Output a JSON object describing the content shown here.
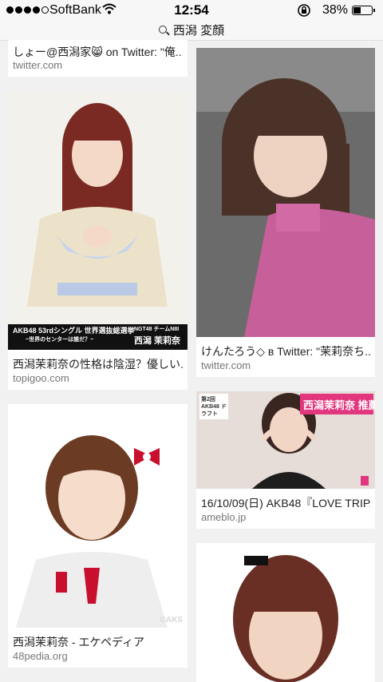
{
  "status_bar": {
    "carrier": "SoftBank",
    "time": "12:54",
    "battery_percent": "38%",
    "battery_level": 0.38,
    "signal_bars_filled": 4,
    "signal_bars_total": 5
  },
  "url_bar": {
    "query": "西潟 変顔"
  },
  "results": [
    {
      "title": "しょー@西潟家😸 on Twitter: \"俺...",
      "source": "twitter.com"
    },
    {
      "title": "けんたろう◇ в Twitter: \"茉莉奈ち...",
      "source": "twitter.com"
    },
    {
      "title": "西潟茉莉奈の性格は陰湿？優しい...",
      "source": "topigoo.com",
      "image_text": {
        "line1": "AKB48 53rdシングル 世界選抜総選挙",
        "line2": "~世界のセンターは誰だ？~",
        "tag": "NGT48 チームNIII",
        "name": "西潟 茉莉奈"
      }
    },
    {
      "title": "16/10/09(日) AKB48『LOVE TRIP...",
      "source": "ameblo.jp",
      "image_text": {
        "banner": "西潟茉莉奈 推薦",
        "left": "第2回 AKB48 ドラフト"
      }
    },
    {
      "title": "西潟茉莉奈 - エケペディア",
      "source": "48pedia.org",
      "image_text": {
        "watermark": "©AKS"
      }
    },
    {
      "title": "",
      "source": ""
    }
  ]
}
